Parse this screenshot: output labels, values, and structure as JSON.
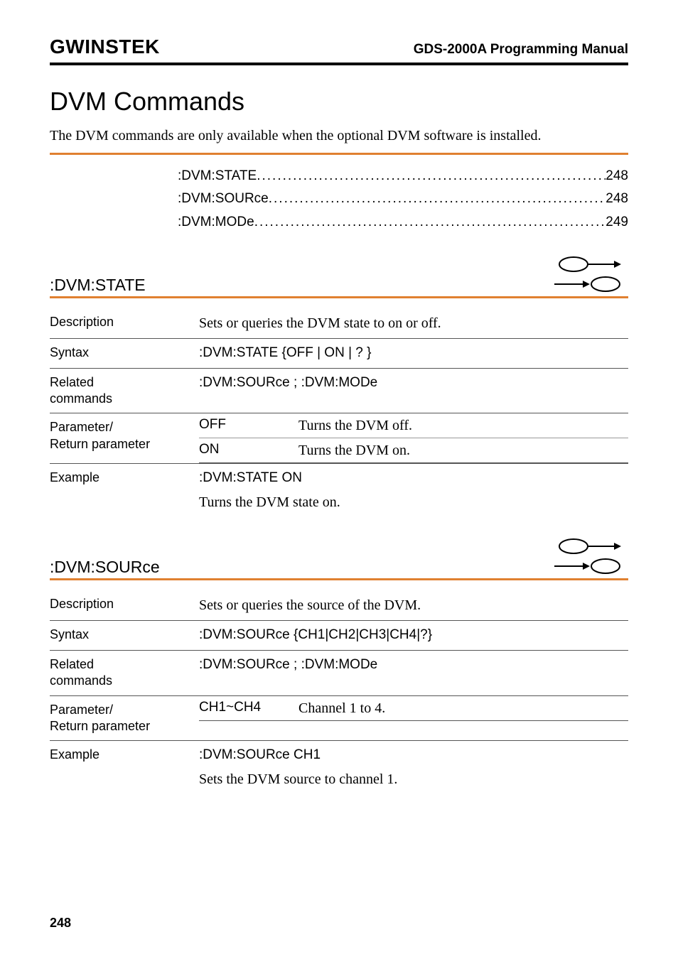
{
  "header": {
    "logo": "GWINSTEK",
    "manual_title": "GDS-2000A Programming Manual"
  },
  "section": {
    "title": "DVM Commands",
    "intro": "The DVM commands are only available when the optional DVM software is installed."
  },
  "toc": [
    {
      "label": ":DVM:STATE",
      "page": "248"
    },
    {
      "label": ":DVM:SOURce",
      "page": "248"
    },
    {
      "label": ":DVM:MODe",
      "page": "249"
    }
  ],
  "cmd1": {
    "name": ":DVM:STATE",
    "description": "Sets or queries the DVM state to on or off.",
    "syntax": ":DVM:STATE {OFF | ON | ? }",
    "related": ":DVM:SOURce ; :DVM:MODe",
    "params": [
      {
        "key": "OFF",
        "val": "Turns the DVM off."
      },
      {
        "key": "ON",
        "val": "Turns the DVM on."
      }
    ],
    "example_cmd": ":DVM:STATE ON",
    "example_desc": "Turns the DVM state on."
  },
  "cmd2": {
    "name": ":DVM:SOURce",
    "description": "Sets or queries the source of the DVM.",
    "syntax": ":DVM:SOURce {CH1|CH2|CH3|CH4|?}",
    "related": ":DVM:SOURce ; :DVM:MODe",
    "params": [
      {
        "key": "CH1~CH4",
        "val": "Channel 1 to 4."
      }
    ],
    "example_cmd": ":DVM:SOURce CH1",
    "example_desc": "Sets the DVM source to channel 1."
  },
  "page_number": "248",
  "dots": "...................................................................................."
}
